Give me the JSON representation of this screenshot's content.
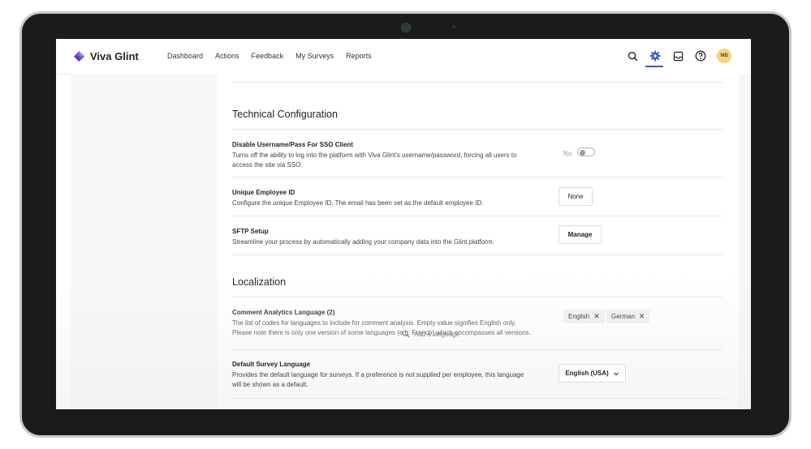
{
  "app": {
    "name": "Viva Glint"
  },
  "nav": {
    "items": [
      "Dashboard",
      "Actions",
      "Feedback",
      "My Surveys",
      "Reports"
    ]
  },
  "header_icons": [
    "search-icon",
    "settings-icon",
    "inbox-icon",
    "help-icon"
  ],
  "avatar": {
    "initials": "MB",
    "color": "#f5d27c"
  },
  "accent_color": "#3b57c4",
  "technical": {
    "title": "Technical Configuration",
    "sso": {
      "title": "Disable Username/Pass For SSO Client",
      "desc": "Turns off the ability to log into the platform with Viva Glint's username/password, forcing all users to access the site via SSO.",
      "toggle_label": "No",
      "enabled": false
    },
    "employee_id": {
      "title": "Unique Employee ID",
      "desc": "Configure the unique Employee ID. The email has been set as the default employee ID.",
      "button": "None"
    },
    "sftp": {
      "title": "SFTP Setup",
      "desc": "Streamline your process by automatically adding your company data into the Glint platform.",
      "button": "Manage"
    }
  },
  "localization": {
    "title": "Localization",
    "comment_lang": {
      "title": "Comment Analytics Language (2)",
      "desc": "The list of codes for languages to include for comment analysis. Empty value signifies English only. Please note there is only one version of some languages (e.g. French) which encompasses all versions.",
      "tags": [
        "English",
        "German"
      ],
      "add_placeholder": "Add a language"
    },
    "default_lang": {
      "title": "Default Survey Language",
      "desc": "Provides the default language for surveys. If a preference is not supplied per employee, this language will be shown as a default.",
      "selected": "English (USA)"
    }
  }
}
